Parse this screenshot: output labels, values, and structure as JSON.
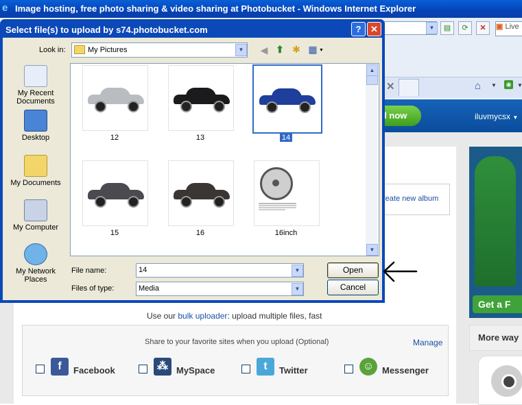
{
  "browser": {
    "title": "Image hosting, free photo sharing & video sharing at Photobucket - Windows Internet Explorer",
    "search_partial": "Live"
  },
  "photobucket": {
    "upload_button_partial": "ad now",
    "username": "iluvmycsx",
    "create_album_partial": "reate new album",
    "bulk_prefix": "Use our",
    "bulk_link": "bulk uploader",
    "bulk_suffix": ": upload multiple files, fast",
    "share_text": "Share to your favorite sites when you upload (Optional)",
    "manage_link": "Manage",
    "share_sites": [
      {
        "label": "Facebook",
        "icon": "facebook-icon",
        "color": "#3b5998"
      },
      {
        "label": "MySpace",
        "icon": "myspace-icon",
        "color": "#2a4a7a"
      },
      {
        "label": "Twitter",
        "icon": "twitter-icon",
        "color": "#4aa8d8"
      },
      {
        "label": "Messenger",
        "icon": "messenger-icon",
        "color": "#5aa33b"
      }
    ],
    "ad_cta_partial": "Get a F",
    "more_ways_partial": "More way"
  },
  "dialog": {
    "title": "Select file(s) to upload by s74.photobucket.com",
    "help_label": "?",
    "close_label": "✕",
    "look_in_label": "Look in:",
    "look_in_value": "My Pictures",
    "places": [
      {
        "label": "My Recent Documents",
        "icon": "recent-documents-icon"
      },
      {
        "label": "Desktop",
        "icon": "desktop-icon"
      },
      {
        "label": "My Documents",
        "icon": "my-documents-icon"
      },
      {
        "label": "My Computer",
        "icon": "my-computer-icon"
      },
      {
        "label": "My Network Places",
        "icon": "network-places-icon"
      }
    ],
    "files": [
      {
        "name": "12",
        "color": "#b9bcc0",
        "selected": false
      },
      {
        "name": "13",
        "color": "#1b1b1d",
        "selected": false
      },
      {
        "name": "14",
        "color": "#1e3f9c",
        "selected": true
      },
      {
        "name": "15",
        "color": "#4a4a50",
        "selected": false
      },
      {
        "name": "16",
        "color": "#3b3534",
        "selected": false
      },
      {
        "name": "16inch",
        "color": "",
        "selected": false
      }
    ],
    "file_name_label": "File name:",
    "file_name_value": "14",
    "file_type_label": "Files of type:",
    "file_type_value": "Media",
    "open_label": "Open",
    "cancel_label": "Cancel"
  },
  "colors": {
    "xp_title_blue": "#0b48b8",
    "dialog_face": "#ece9d8",
    "selection": "#316ac5"
  }
}
